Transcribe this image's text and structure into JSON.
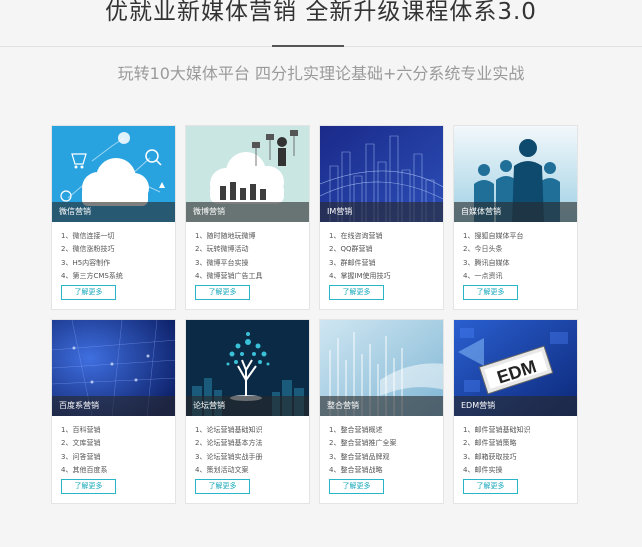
{
  "header": {
    "title": "优就业新媒体营销  全新升级课程体系3.0",
    "subtitle": "玩转10大媒体平台  四分扎实理论基础+六分系统专业实战"
  },
  "more_label": "了解更多",
  "cards": [
    {
      "title": "微信营销",
      "items": [
        "1、微信连接一切",
        "2、微信涨粉技巧",
        "3、H5内容制作",
        "4、第三方CMS系统"
      ]
    },
    {
      "title": "微博营销",
      "items": [
        "1、随时随地玩微博",
        "2、玩转微博活动",
        "3、微博平台实操",
        "4、微博营销广告工具"
      ]
    },
    {
      "title": "IM营销",
      "items": [
        "1、在线咨询营销",
        "2、QQ群营销",
        "3、群邮件营销",
        "4、掌握IM使用技巧"
      ]
    },
    {
      "title": "自媒体营销",
      "items": [
        "1、搜狐自媒体平台",
        "2、今日头条",
        "3、腾讯自媒体",
        "4、一点资讯"
      ]
    },
    {
      "title": "百度系营销",
      "items": [
        "1、百科营销",
        "2、文库营销",
        "3、问答营销",
        "4、其他百度系"
      ]
    },
    {
      "title": "论坛营销",
      "items": [
        "1、论坛营销基础知识",
        "2、论坛营销基本方法",
        "3、论坛营销实战手册",
        "4、策划活动文案"
      ]
    },
    {
      "title": "整合营销",
      "items": [
        "1、整合营销概述",
        "2、整合营销推广全案",
        "3、整合营销品牌观",
        "4、整合营销战略"
      ]
    },
    {
      "title": "EDM营销",
      "items": [
        "1、邮件营销基础知识",
        "2、邮件营销策略",
        "3、邮箱获取技巧",
        "4、邮件实操"
      ]
    }
  ],
  "thumb_texts": {
    "edm": "EDM"
  }
}
